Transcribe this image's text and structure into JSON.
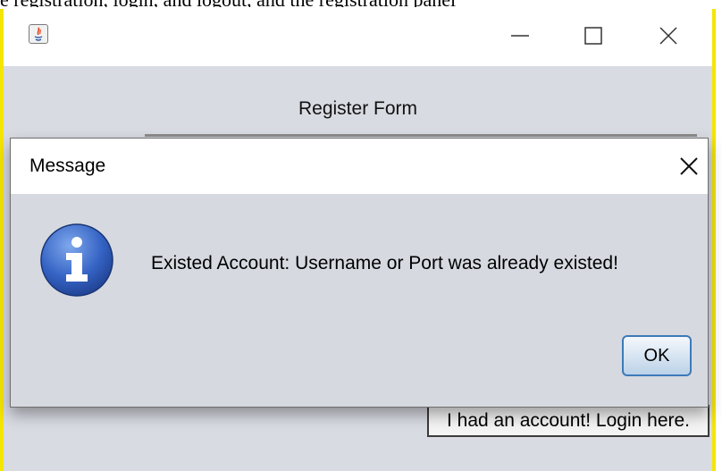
{
  "top_text": "e registration, login, and logout, and the registration panel",
  "main_window": {
    "title": "",
    "form_title": "Register Form",
    "login_button_label": "I had an account! Login here."
  },
  "dialog": {
    "title": "Message",
    "message": "Existed Account: Username or Port was already existed!",
    "ok_label": "OK",
    "icon": "info-icon"
  },
  "colors": {
    "window_bg": "#d9dbe3",
    "dialog_bg": "#d6d9e0",
    "highlight_border": "#f5e600",
    "info_blue": "#2d5fb8",
    "ok_border": "#3d7ab8"
  }
}
